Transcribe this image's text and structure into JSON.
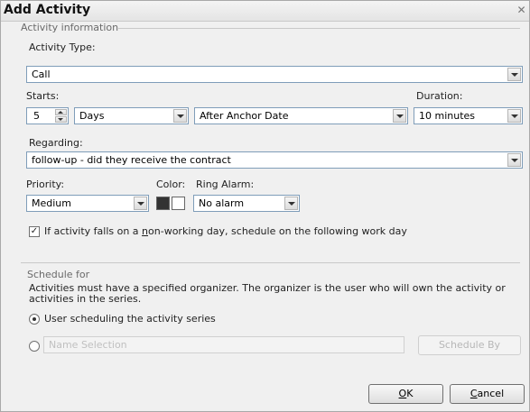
{
  "dialog": {
    "title": "Add Activity",
    "close_glyph": "✕"
  },
  "activity_info": {
    "group_label": "Activity information",
    "activity_type_label": "Activity Type:",
    "activity_type_value": "Call",
    "starts_label": "Starts:",
    "starts_number": "5",
    "starts_unit": "Days",
    "starts_anchor": "After Anchor Date",
    "duration_label": "Duration:",
    "duration_value": "10 minutes",
    "regarding_label": "Regarding:",
    "regarding_value": "follow-up - did they receive the contract",
    "priority_label": "Priority:",
    "priority_value": "Medium",
    "color_label": "Color:",
    "color_swatches": [
      "#333333",
      "#ffffff"
    ],
    "ring_alarm_label": "Ring Alarm:",
    "ring_alarm_value": "No alarm",
    "nonworking_checkbox_checked": true,
    "nonworking_text_before": "If activity falls on a ",
    "nonworking_text_underlined": "n",
    "nonworking_text_after": "on-working day, schedule on the following work day"
  },
  "schedule": {
    "group_label": "Schedule for",
    "description": "Activities must have a specified organizer. The organizer is the user who will own the activity or activities in the series.",
    "option_user_label": "User scheduling the activity series",
    "option_user_selected": true,
    "option_name_label": "Name Selection",
    "option_name_selected": false,
    "select_button_label": "Schedule By"
  },
  "buttons": {
    "ok": "OK",
    "ok_underline": "O",
    "ok_rest": "K",
    "cancel": "Cancel",
    "cancel_underline": "C",
    "cancel_rest": "ancel"
  }
}
